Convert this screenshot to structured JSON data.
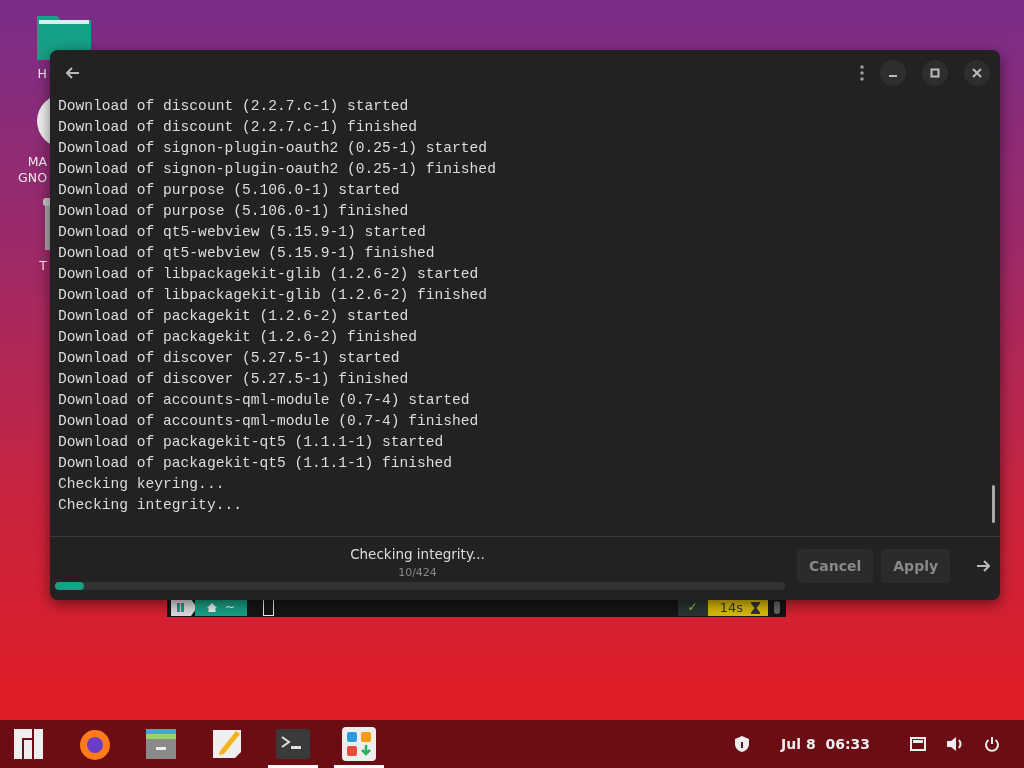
{
  "desktop_icons": [
    {
      "kind": "folder",
      "label_lines": [
        "H"
      ]
    },
    {
      "kind": "disc",
      "label_lines": [
        "MA",
        "GNO"
      ]
    },
    {
      "kind": "trash",
      "label_lines": [
        "T"
      ]
    }
  ],
  "terminal_behind": {
    "prompt_dir": "~",
    "status": "✓",
    "duration": "14s"
  },
  "dialog": {
    "log_lines": [
      "Download of discount (2.2.7.c-1) started",
      "Download of discount (2.2.7.c-1) finished",
      "Download of signon-plugin-oauth2 (0.25-1) started",
      "Download of signon-plugin-oauth2 (0.25-1) finished",
      "Download of purpose (5.106.0-1) started",
      "Download of purpose (5.106.0-1) finished",
      "Download of qt5-webview (5.15.9-1) started",
      "Download of qt5-webview (5.15.9-1) finished",
      "Download of libpackagekit-glib (1.2.6-2) started",
      "Download of libpackagekit-glib (1.2.6-2) finished",
      "Download of packagekit (1.2.6-2) started",
      "Download of packagekit (1.2.6-2) finished",
      "Download of discover (5.27.5-1) started",
      "Download of discover (5.27.5-1) finished",
      "Download of accounts-qml-module (0.7-4) started",
      "Download of accounts-qml-module (0.7-4) finished",
      "Download of packagekit-qt5 (1.1.1-1) started",
      "Download of packagekit-qt5 (1.1.1-1) finished",
      "Checking keyring...",
      "Checking integrity..."
    ],
    "status": "Checking integrity...",
    "count": "10/424",
    "progress": {
      "level": 0.04
    },
    "buttons": [
      {
        "label": "Cancel",
        "disabled": true
      },
      {
        "label": "Apply",
        "disabled": true
      }
    ]
  },
  "taskbar": {
    "apps": [
      {
        "kind": "menu",
        "running": false
      },
      {
        "kind": "browser",
        "running": false
      },
      {
        "kind": "files",
        "running": false
      },
      {
        "kind": "editor",
        "running": false
      },
      {
        "kind": "terminal",
        "running": true
      },
      {
        "kind": "software",
        "running": true
      }
    ],
    "clock": "Jul 8  06:33"
  }
}
